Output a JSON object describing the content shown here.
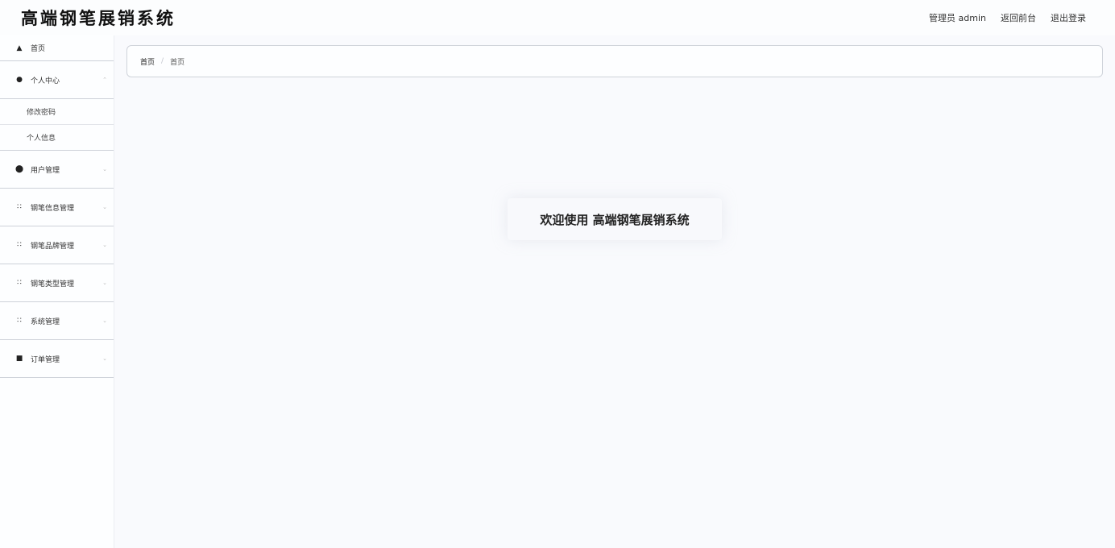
{
  "header": {
    "title": "高端钢笔展销系统",
    "admin_label": "管理员 admin",
    "front_link": "返回前台",
    "logout_link": "退出登录"
  },
  "sidebar": {
    "items": [
      {
        "label": "首页",
        "icon": "home-icon"
      },
      {
        "label": "个人中心",
        "icon": "user-icon",
        "children": [
          "修改密码",
          "个人信息"
        ]
      },
      {
        "label": "用户管理",
        "icon": "users-icon"
      },
      {
        "label": "钢笔信息管理",
        "icon": "grid-icon"
      },
      {
        "label": "钢笔品牌管理",
        "icon": "grid-icon"
      },
      {
        "label": "钢笔类型管理",
        "icon": "grid-icon"
      },
      {
        "label": "系统管理",
        "icon": "grid-icon"
      },
      {
        "label": "订单管理",
        "icon": "order-icon"
      }
    ]
  },
  "breadcrumb": {
    "home": "首页",
    "current": "首页"
  },
  "main": {
    "welcome": "欢迎使用 高端钢笔展销系统"
  }
}
